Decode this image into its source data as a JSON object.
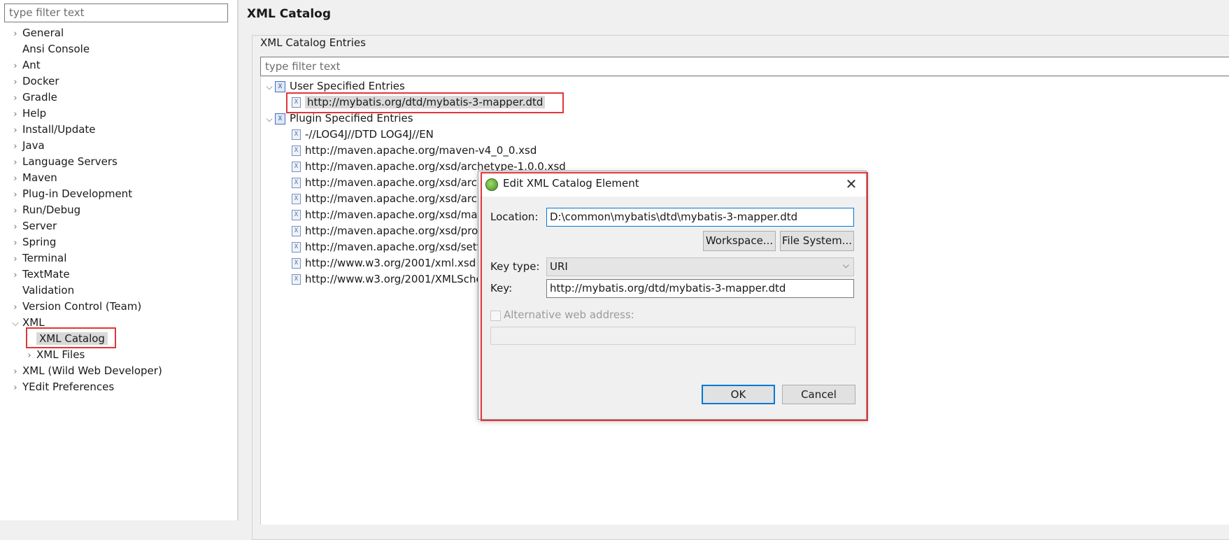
{
  "sidebar": {
    "filter_placeholder": "type filter text",
    "items": [
      {
        "label": "General",
        "expandable": true
      },
      {
        "label": "Ansi Console",
        "expandable": false
      },
      {
        "label": "Ant",
        "expandable": true
      },
      {
        "label": "Docker",
        "expandable": true
      },
      {
        "label": "Gradle",
        "expandable": true
      },
      {
        "label": "Help",
        "expandable": true
      },
      {
        "label": "Install/Update",
        "expandable": true
      },
      {
        "label": "Java",
        "expandable": true
      },
      {
        "label": "Language Servers",
        "expandable": true
      },
      {
        "label": "Maven",
        "expandable": true
      },
      {
        "label": "Plug-in Development",
        "expandable": true
      },
      {
        "label": "Run/Debug",
        "expandable": true
      },
      {
        "label": "Server",
        "expandable": true
      },
      {
        "label": "Spring",
        "expandable": true
      },
      {
        "label": "Terminal",
        "expandable": true
      },
      {
        "label": "TextMate",
        "expandable": true
      },
      {
        "label": "Validation",
        "expandable": false
      },
      {
        "label": "Version Control (Team)",
        "expandable": true
      },
      {
        "label": "XML",
        "expandable": true,
        "expanded": true
      },
      {
        "label": "XML Catalog",
        "expandable": false,
        "selected": true
      },
      {
        "label": "XML Files",
        "expandable": true
      },
      {
        "label": "XML (Wild Web Developer)",
        "expandable": true
      },
      {
        "label": "YEdit Preferences",
        "expandable": true
      }
    ]
  },
  "main": {
    "title": "XML Catalog",
    "group_label": "XML Catalog Entries",
    "filter_placeholder": "type filter text",
    "tree": {
      "user_group": "User Specified Entries",
      "user_entries": [
        "http://mybatis.org/dtd/mybatis-3-mapper.dtd"
      ],
      "plugin_group": "Plugin Specified Entries",
      "plugin_entries": [
        "-//LOG4J//DTD LOG4J//EN",
        "http://maven.apache.org/maven-v4_0_0.xsd",
        "http://maven.apache.org/xsd/archetype-1.0.0.xsd",
        "http://maven.apache.org/xsd/arch",
        "http://maven.apache.org/xsd/arch",
        "http://maven.apache.org/xsd/mav",
        "http://maven.apache.org/xsd/prof",
        "http://maven.apache.org/xsd/setti",
        "http://www.w3.org/2001/xml.xsd",
        "http://www.w3.org/2001/XMLSche"
      ]
    }
  },
  "dialog": {
    "title": "Edit XML Catalog Element",
    "location_label": "Location:",
    "location_value": "D:\\common\\mybatis\\dtd\\mybatis-3-mapper.dtd",
    "workspace_button": "Workspace...",
    "filesystem_button": "File System...",
    "keytype_label": "Key type:",
    "keytype_value": "URI",
    "key_label": "Key:",
    "key_value": "http://mybatis.org/dtd/mybatis-3-mapper.dtd",
    "alt_web_label": "Alternative web address:",
    "ok_button": "OK",
    "cancel_button": "Cancel"
  },
  "colors": {
    "highlight_border": "#e0363a",
    "focus_blue": "#0078d7",
    "selection_gray": "#d9d9d9"
  }
}
